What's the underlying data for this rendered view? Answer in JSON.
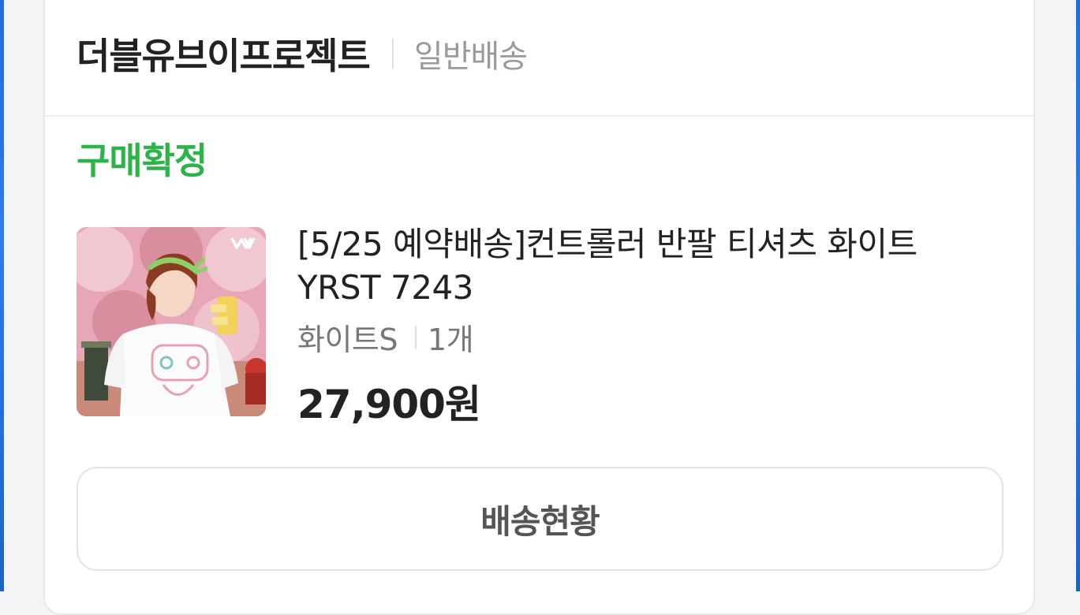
{
  "seller": {
    "name": "더블유브이프로젝트",
    "delivery_type": "일반배송"
  },
  "order": {
    "status": "구매확정",
    "status_color": "#2db34a"
  },
  "product": {
    "name": "[5/25 예약배송]컨트롤러 반팔 티셔츠 화이트 YRST 7243",
    "option": "화이트S",
    "quantity": "1개",
    "price": "27,900원",
    "thumbnail_logo_icon": "wv-logo-icon"
  },
  "actions": {
    "track_label": "배송현황"
  },
  "colors": {
    "accent_green": "#2db34a",
    "frame_blue": "#2a7ee8"
  }
}
